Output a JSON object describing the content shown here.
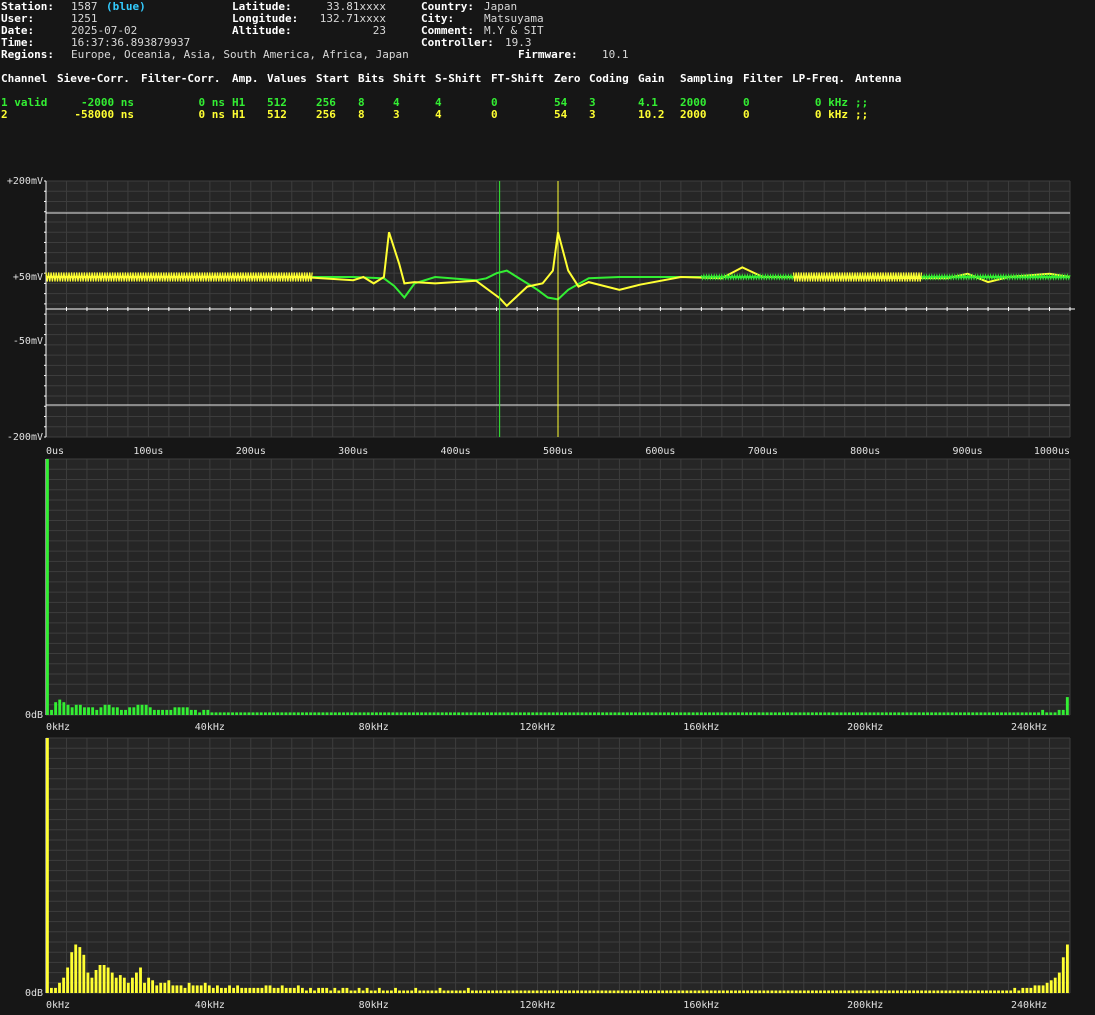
{
  "info": {
    "station_label": "Station:",
    "station": "1587",
    "station_color": "(blue)",
    "user_label": "User:",
    "user": "1251",
    "date_label": "Date:",
    "date": "2025-07-02",
    "time_label": "Time:",
    "time": "16:37:36.893879937",
    "regions_label": "Regions:",
    "regions": "Europe, Oceania, Asia, South America, Africa, Japan",
    "latitude_label": "Latitude:",
    "latitude": "33.81xxxx",
    "longitude_label": "Longitude:",
    "longitude": "132.71xxxx",
    "altitude_label": "Altitude:",
    "altitude": "23",
    "country_label": "Country:",
    "country": "Japan",
    "city_label": "City:",
    "city": "Matsuyama",
    "comment_label": "Comment:",
    "comment": "M.Y & SIT",
    "controller_label": "Controller:",
    "controller": "19.3",
    "firmware_label": "Firmware:",
    "firmware": "10.1"
  },
  "table": {
    "headers": [
      "Channel",
      "Sieve-Corr.",
      "Filter-Corr.",
      "Amp.",
      "Values",
      "Start",
      "Bits",
      "Shift",
      "S-Shift",
      "FT-Shift",
      "Zero",
      "Coding",
      "Gain",
      "Sampling",
      "Filter",
      "LP-Freq.",
      "Antenna"
    ],
    "rows": [
      [
        "1 valid",
        "-2000 ns",
        "0 ns",
        "H1",
        "512",
        "256",
        "8",
        "4",
        "4",
        "0",
        "54",
        "3",
        "4.1",
        "2000",
        "0",
        "0 kHz",
        ";;"
      ],
      [
        "2",
        "-58000 ns",
        "0 ns",
        "H1",
        "512",
        "256",
        "8",
        "3",
        "4",
        "0",
        "54",
        "3",
        "10.2",
        "2000",
        "0",
        "0 kHz",
        ";;"
      ]
    ]
  },
  "colors": {
    "channel1": "#33ee33",
    "channel2": "#ffff33",
    "background": "#161616",
    "grid": "#3a3a3a"
  },
  "chart_data": [
    {
      "type": "line",
      "y_tick_labels": [
        "+200mV",
        "+50mV",
        "-50mV",
        "-200mV"
      ],
      "x_tick_labels": [
        "0us",
        "100us",
        "200us",
        "300us",
        "400us",
        "500us",
        "600us",
        "700us",
        "800us",
        "900us",
        "1000us"
      ],
      "xlim": [
        0,
        1000
      ],
      "ylim": [
        -200,
        200
      ],
      "grid": true,
      "cursors": [
        {
          "series": "1",
          "x": 443
        },
        {
          "series": "2",
          "x": 500
        }
      ],
      "series": [
        {
          "name": "1",
          "points": [
            [
              0,
              50
            ],
            [
              120,
              50
            ],
            [
              250,
              50
            ],
            [
              300,
              50
            ],
            [
              330,
              48
            ],
            [
              340,
              36
            ],
            [
              350,
              18
            ],
            [
              360,
              40
            ],
            [
              380,
              50
            ],
            [
              420,
              45
            ],
            [
              430,
              48
            ],
            [
              440,
              56
            ],
            [
              450,
              60
            ],
            [
              460,
              50
            ],
            [
              470,
              40
            ],
            [
              480,
              30
            ],
            [
              490,
              18
            ],
            [
              500,
              15
            ],
            [
              510,
              30
            ],
            [
              530,
              48
            ],
            [
              560,
              50
            ],
            [
              600,
              50
            ],
            [
              640,
              50
            ],
            [
              700,
              50
            ],
            [
              1000,
              50
            ]
          ]
        },
        {
          "name": "2",
          "points": [
            [
              0,
              50
            ],
            [
              120,
              50
            ],
            [
              250,
              50
            ],
            [
              300,
              45
            ],
            [
              310,
              50
            ],
            [
              320,
              40
            ],
            [
              330,
              50
            ],
            [
              335,
              120
            ],
            [
              345,
              70
            ],
            [
              350,
              40
            ],
            [
              360,
              42
            ],
            [
              380,
              40
            ],
            [
              420,
              44
            ],
            [
              443,
              17
            ],
            [
              450,
              5
            ],
            [
              470,
              35
            ],
            [
              485,
              40
            ],
            [
              495,
              60
            ],
            [
              500,
              120
            ],
            [
              505,
              90
            ],
            [
              510,
              60
            ],
            [
              520,
              35
            ],
            [
              530,
              42
            ],
            [
              560,
              30
            ],
            [
              580,
              38
            ],
            [
              620,
              50
            ],
            [
              660,
              48
            ],
            [
              680,
              65
            ],
            [
              700,
              50
            ],
            [
              880,
              48
            ],
            [
              900,
              55
            ],
            [
              920,
              42
            ],
            [
              940,
              50
            ],
            [
              980,
              55
            ],
            [
              1000,
              50
            ]
          ]
        }
      ]
    },
    {
      "type": "bar",
      "x_tick_labels": [
        "0kHz",
        "40kHz",
        "80kHz",
        "120kHz",
        "160kHz",
        "200kHz",
        "240kHz"
      ],
      "y_tick_labels": [
        "0dB"
      ],
      "xlim": [
        0,
        250
      ],
      "series": [
        {
          "name": "1",
          "values": [
            100,
            2,
            5,
            6,
            5,
            4,
            3,
            4,
            4,
            3,
            3,
            3,
            2,
            3,
            4,
            4,
            3,
            3,
            2,
            2,
            3,
            3,
            4,
            4,
            4,
            3,
            2,
            2,
            2,
            2,
            2,
            3,
            3,
            3,
            3,
            2,
            2,
            1,
            2,
            2,
            1,
            1,
            1,
            1,
            1,
            1,
            1,
            1,
            1,
            1,
            1,
            1,
            1,
            1,
            1,
            1,
            1,
            1,
            1,
            1,
            1,
            1,
            1,
            1,
            1,
            1,
            1,
            1,
            1,
            1,
            1,
            1,
            1,
            1,
            1,
            1,
            1,
            1,
            1,
            1,
            1,
            1,
            1,
            1,
            1,
            1,
            1,
            1,
            1,
            1,
            1,
            1,
            1,
            1,
            1,
            1,
            1,
            1,
            1,
            1,
            1,
            1,
            1,
            1,
            1,
            1,
            1,
            1,
            1,
            1,
            1,
            1,
            1,
            1,
            1,
            1,
            1,
            1,
            1,
            1,
            1,
            1,
            1,
            1,
            1,
            1,
            1,
            1,
            1,
            1,
            1,
            1,
            1,
            1,
            1,
            1,
            1,
            1,
            1,
            1,
            1,
            1,
            1,
            1,
            1,
            1,
            1,
            1,
            1,
            1,
            1,
            1,
            1,
            1,
            1,
            1,
            1,
            1,
            1,
            1,
            1,
            1,
            1,
            1,
            1,
            1,
            1,
            1,
            1,
            1,
            1,
            1,
            1,
            1,
            1,
            1,
            1,
            1,
            1,
            1,
            1,
            1,
            1,
            1,
            1,
            1,
            1,
            1,
            1,
            1,
            1,
            1,
            1,
            1,
            1,
            1,
            1,
            1,
            1,
            1,
            1,
            1,
            1,
            1,
            1,
            1,
            1,
            1,
            1,
            1,
            1,
            1,
            1,
            1,
            1,
            1,
            1,
            1,
            1,
            1,
            1,
            1,
            1,
            1,
            1,
            1,
            1,
            1,
            1,
            1,
            1,
            1,
            1,
            1,
            1,
            1,
            1,
            1,
            1,
            1,
            1,
            1,
            2,
            1,
            1,
            1,
            2,
            2,
            7
          ]
        }
      ]
    },
    {
      "type": "bar",
      "x_tick_labels": [
        "0kHz",
        "40kHz",
        "80kHz",
        "120kHz",
        "160kHz",
        "200kHz",
        "240kHz"
      ],
      "y_tick_labels": [
        "0dB"
      ],
      "xlim": [
        0,
        250
      ],
      "series": [
        {
          "name": "2",
          "values": [
            100,
            2,
            2,
            4,
            6,
            10,
            16,
            19,
            18,
            15,
            8,
            6,
            9,
            11,
            11,
            10,
            8,
            6,
            7,
            6,
            4,
            6,
            8,
            10,
            4,
            6,
            5,
            3,
            4,
            4,
            5,
            3,
            3,
            3,
            2,
            4,
            3,
            3,
            3,
            4,
            3,
            2,
            3,
            2,
            2,
            3,
            2,
            3,
            2,
            2,
            2,
            2,
            2,
            2,
            3,
            3,
            2,
            2,
            3,
            2,
            2,
            2,
            3,
            2,
            1,
            2,
            1,
            2,
            2,
            2,
            1,
            2,
            1,
            2,
            2,
            1,
            1,
            2,
            1,
            2,
            1,
            1,
            2,
            1,
            1,
            1,
            2,
            1,
            1,
            1,
            1,
            2,
            1,
            1,
            1,
            1,
            1,
            2,
            1,
            1,
            1,
            1,
            1,
            1,
            2,
            1,
            1,
            1,
            1,
            1,
            1,
            1,
            1,
            1,
            1,
            1,
            1,
            1,
            1,
            1,
            1,
            1,
            1,
            1,
            1,
            1,
            1,
            1,
            1,
            1,
            1,
            1,
            1,
            1,
            1,
            1,
            1,
            1,
            1,
            1,
            1,
            1,
            1,
            1,
            1,
            1,
            1,
            1,
            1,
            1,
            1,
            1,
            1,
            1,
            1,
            1,
            1,
            1,
            1,
            1,
            1,
            1,
            1,
            1,
            1,
            1,
            1,
            1,
            1,
            1,
            1,
            1,
            1,
            1,
            1,
            1,
            1,
            1,
            1,
            1,
            1,
            1,
            1,
            1,
            1,
            1,
            1,
            1,
            1,
            1,
            1,
            1,
            1,
            1,
            1,
            1,
            1,
            1,
            1,
            1,
            1,
            1,
            1,
            1,
            1,
            1,
            1,
            1,
            1,
            1,
            1,
            1,
            1,
            1,
            1,
            1,
            1,
            1,
            1,
            1,
            1,
            1,
            1,
            1,
            1,
            1,
            1,
            1,
            1,
            1,
            1,
            1,
            1,
            1,
            1,
            1,
            1,
            1,
            1,
            2,
            1,
            2,
            2,
            2,
            3,
            3,
            3,
            4,
            5,
            6,
            8,
            14,
            19
          ]
        }
      ]
    }
  ]
}
